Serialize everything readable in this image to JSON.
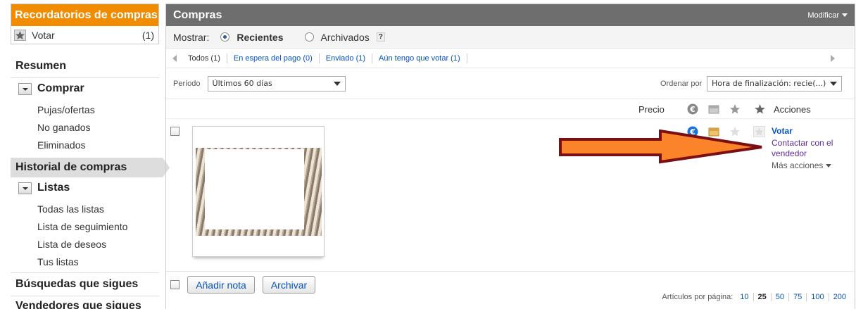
{
  "sidebar": {
    "reminders_title": "Recordatorios de compras",
    "vote_label": "Votar",
    "vote_count": "(1)",
    "summary": "Resumen",
    "buy_group": "Comprar",
    "buy_items": [
      "Pujas/ofertas",
      "No ganados",
      "Eliminados"
    ],
    "history": "Historial de compras",
    "lists_group": "Listas",
    "lists_items": [
      "Todas las listas",
      "Lista de seguimiento",
      "Lista de deseos",
      "Tus listas"
    ],
    "saved_searches": "Búsquedas que sigues",
    "followed_sellers": "Vendedores que sigues"
  },
  "main": {
    "title": "Compras",
    "modify": "Modificar",
    "show_label": "Mostrar:",
    "show_recent": "Recientes",
    "show_archived": "Archivados",
    "help": "?",
    "tabs": [
      {
        "label": "Todos (1)",
        "active": true
      },
      {
        "label": "En espera del pago (0)",
        "active": false
      },
      {
        "label": "Enviado (1)",
        "active": false
      },
      {
        "label": "Aún tengo que votar (1)",
        "active": false
      }
    ],
    "period_label": "Período",
    "period_value": "Últimos 60 días",
    "sort_label": "Ordenar por",
    "sort_value": "Hora de finalización: recie(...)",
    "col_price": "Precio",
    "col_actions": "Acciones",
    "action_vote": "Votar",
    "action_contact": "Contactar con el vendedor",
    "action_more": "Más acciones",
    "add_note": "Añadir nota",
    "archive": "Archivar",
    "per_page_label": "Artículos por página:",
    "per_page_options": [
      "10",
      "25",
      "50",
      "75",
      "100",
      "200"
    ],
    "per_page_selected": "25"
  },
  "icons": {
    "euro": "euro-icon",
    "ship": "package-icon",
    "star": "star-icon"
  },
  "colors": {
    "accent_orange": "#f18c00",
    "header_gray": "#6e6e6e",
    "link_blue": "#0654ba",
    "arrow_fill": "#fb8329",
    "arrow_stroke": "#7a0f14"
  }
}
